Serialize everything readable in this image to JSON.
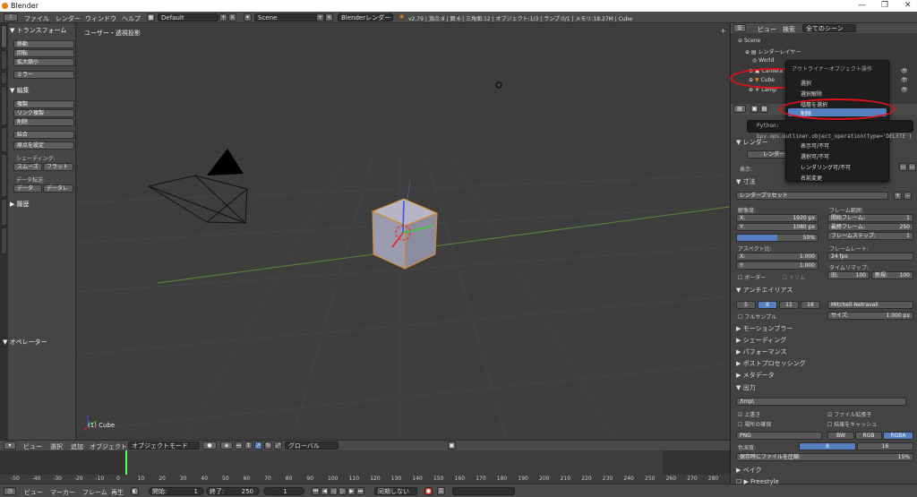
{
  "window": {
    "title": "Blender"
  },
  "infobar": {
    "menus": [
      "ファイル",
      "レンダー",
      "ウィンドウ",
      "ヘルプ"
    ],
    "screen": "Default",
    "scene": "Scene",
    "engine": "Blenderレンダー",
    "stats": "v2.79 | 頂点:8 | 面:6 | 三角面:12 | オブジェクト:1/3 | ランプ:0/1 | メモリ:18.27M | Cube"
  },
  "tools": {
    "transform": "▼ トランスフォーム",
    "move": "移動",
    "rotate": "回転",
    "scale": "拡大縮小",
    "mirror": "ミラー",
    "edit": "▼ 編集",
    "duplicate": "複製",
    "link_dup": "リンク複製",
    "delete": "削除",
    "join": "結合",
    "origin": "原点を設定",
    "shading_label": "シェーディング:",
    "smooth": "スムーズ",
    "flat": "フラット",
    "data_label": "データ転送:",
    "data": "データ",
    "data2": "データレ",
    "history": "▶ 履歴",
    "operator": "▼ オペレーター"
  },
  "lefttabs": [
    "ツール",
    "作成",
    "関係",
    "アニメーション",
    "物理演算",
    "グリースペンシル",
    "Tools",
    "Tools2"
  ],
  "viewport": {
    "title": "ユーザー・透視投影",
    "object": "(1) Cube"
  },
  "view_header": {
    "menus": [
      "ビュー",
      "選択",
      "追加",
      "オブジェクト"
    ],
    "mode": "オブジェクトモード",
    "orientation": "グローバル"
  },
  "timeline": {
    "ticks": [
      "-50",
      "-40",
      "-30",
      "-20",
      "-10",
      "0",
      "10",
      "20",
      "30",
      "40",
      "50",
      "60",
      "70",
      "80",
      "90",
      "100",
      "110",
      "120",
      "130",
      "140",
      "150",
      "160",
      "170",
      "180",
      "190",
      "200",
      "210",
      "220",
      "230",
      "240",
      "250",
      "260",
      "270",
      "280"
    ],
    "current_frame": 1
  },
  "timeline_header": {
    "menus": [
      "ビュー",
      "マーカー",
      "フレーム",
      "再生"
    ],
    "start_label": "開始:",
    "start": "1",
    "end_label": "終了:",
    "end": "250",
    "frame": "1",
    "sync": "同期しない"
  },
  "outliner": {
    "menus": [
      "ビュー",
      "検索"
    ],
    "filter": "全てのシーン",
    "items": [
      "Scene",
      "レンダーレイヤー",
      "World",
      "Camera",
      "Cube",
      "Lamp"
    ]
  },
  "context_menu": {
    "title": "アウトライナーオブジェクト操作",
    "items": [
      "選択",
      "選択解除",
      "階層を選択",
      "削除",
      "表示可/不可",
      "選択可/不可",
      "レンダリング可/不可",
      "名前変更"
    ]
  },
  "tooltip": {
    "text": "Python: bpy.ops.outliner.object_operation(type='DELETE')"
  },
  "props": {
    "render": "▼ レンダー",
    "render_btn": "レンダー",
    "display_label": "表示:",
    "dimensions": "▼ 寸法",
    "preset": "レンダープリセット",
    "resolution": "解像度:",
    "res_x": "X:",
    "res_x_val": "1920 px",
    "res_y": "Y:",
    "res_y_val": "1080 px",
    "res_pct": "50%",
    "frame_range": "フレーム範囲:",
    "start": "開始フレーム:",
    "start_val": "1",
    "end": "最終フレーム:",
    "end_val": "250",
    "step": "フレームステップ:",
    "step_val": "1",
    "aspect": "アスペクト比:",
    "asp_x": "X:",
    "asp_x_val": "1.000",
    "asp_y": "Y:",
    "asp_y_val": "1.000",
    "fps_label": "フレームレート:",
    "fps": "24 fps",
    "remap": "タイムリマップ:",
    "old": "旧:",
    "old_val": "100",
    "new": "新規:",
    "new_val": "100",
    "border": "ボーダー",
    "crop": "トリム",
    "aa": "▼ アンチエイリアス",
    "aa_opts": [
      "5",
      "8",
      "11",
      "16"
    ],
    "aa_filter": "Mitchell-Netravali",
    "full_sample": "フルサンプル",
    "size_label": "サイズ:",
    "size_val": "1.000 px",
    "motion_blur": "▶ モーションブラー",
    "shading": "▶ シェーディング",
    "performance": "▶ パフォーマンス",
    "post": "▶ ポストプロセッシング",
    "metadata": "▶ メタデータ",
    "output": "▼ 出力",
    "path": "/tmp\\",
    "overwrite": "上書き",
    "placeholders": "場所の確保",
    "file_ext": "ファイル拡張子",
    "cache": "結果をキャッシュ",
    "format": "PNG",
    "bw": "BW",
    "rgb": "RGB",
    "rgba": "RGBA",
    "depth_label": "色深度:",
    "depth8": "8",
    "depth16": "16",
    "compress": "保存時にファイルを圧縮:",
    "compress_val": "15%",
    "bake": "▶ ベイク",
    "freestyle": "▶ Freestyle"
  }
}
